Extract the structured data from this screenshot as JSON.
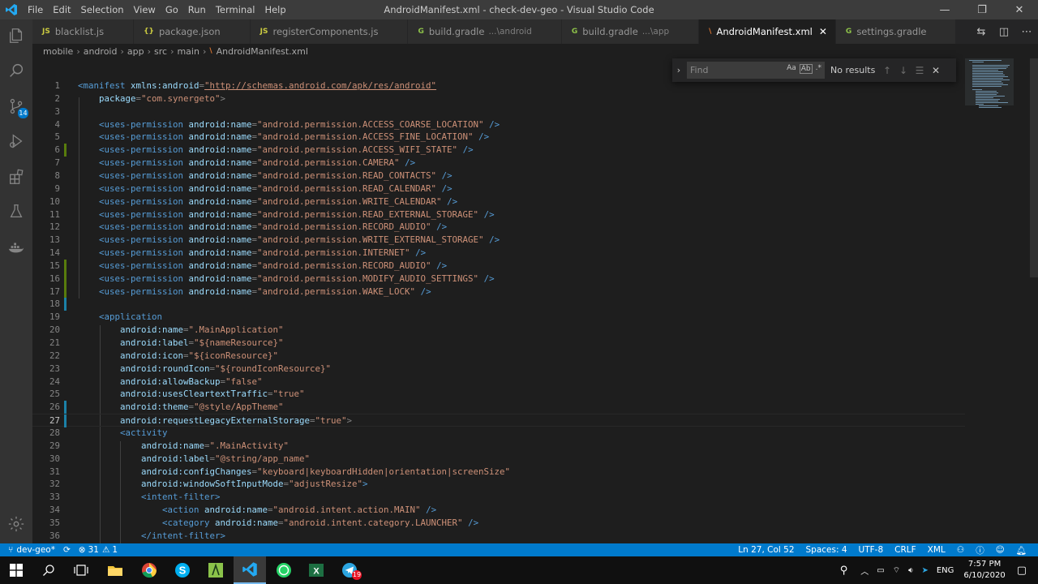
{
  "window": {
    "title": "AndroidManifest.xml - check-dev-geo - Visual Studio Code",
    "menu": [
      "File",
      "Edit",
      "Selection",
      "View",
      "Go",
      "Run",
      "Terminal",
      "Help"
    ],
    "controls": {
      "minimize": "—",
      "maximize": "❐",
      "close": "✕"
    }
  },
  "activity_bar": {
    "icons": [
      "files-icon",
      "search-icon",
      "source-control-icon",
      "run-debug-icon",
      "extensions-icon",
      "testing-icon",
      "docker-icon",
      "settings-gear-icon"
    ],
    "scm_badge": "14"
  },
  "tabs": [
    {
      "icon": "JS",
      "icon_color": "#cbcb41",
      "label": "blacklist.js",
      "desc": ""
    },
    {
      "icon": "{}",
      "icon_color": "#cbcb41",
      "label": "package.json",
      "desc": ""
    },
    {
      "icon": "JS",
      "icon_color": "#cbcb41",
      "label": "registerComponents.js",
      "desc": ""
    },
    {
      "icon": "G",
      "icon_color": "#8dc149",
      "label": "build.gradle",
      "desc": "...\\android"
    },
    {
      "icon": "G",
      "icon_color": "#8dc149",
      "label": "build.gradle",
      "desc": "...\\app"
    },
    {
      "icon": "\\",
      "icon_color": "#e37933",
      "label": "AndroidManifest.xml",
      "desc": "",
      "active": true
    },
    {
      "icon": "G",
      "icon_color": "#8dc149",
      "label": "settings.gradle",
      "desc": ""
    }
  ],
  "breadcrumb": [
    "mobile",
    "android",
    "app",
    "src",
    "main",
    "AndroidManifest.xml"
  ],
  "find": {
    "placeholder": "Find",
    "result": "No results",
    "opt_case": "Aa",
    "opt_word": "Ab",
    "opt_regex": ".*"
  },
  "code": {
    "lines": [
      {
        "n": "1",
        "segs": [
          [
            "t",
            "<manifest "
          ],
          [
            "a",
            "xmlns:android"
          ],
          [
            "b",
            "="
          ],
          [
            "u",
            "\"http://schemas.android.com/apk/res/android\""
          ]
        ]
      },
      {
        "n": "2",
        "segs": [
          [
            "a",
            "    package"
          ],
          [
            "b",
            "="
          ],
          [
            "s",
            "\"com.synergeto\""
          ],
          [
            "b",
            ">"
          ]
        ]
      },
      {
        "n": "3",
        "segs": []
      },
      {
        "n": "4",
        "segs": [
          [
            "t",
            "    <uses-permission "
          ],
          [
            "a",
            "android:name"
          ],
          [
            "b",
            "="
          ],
          [
            "s",
            "\"android.permission.ACCESS_COARSE_LOCATION\""
          ],
          [
            "t",
            " />"
          ]
        ]
      },
      {
        "n": "5",
        "segs": [
          [
            "t",
            "    <uses-permission "
          ],
          [
            "a",
            "android:name"
          ],
          [
            "b",
            "="
          ],
          [
            "s",
            "\"android.permission.ACCESS_FINE_LOCATION\""
          ],
          [
            "t",
            " />"
          ]
        ]
      },
      {
        "n": "6",
        "segs": [
          [
            "t",
            "    <uses-permission "
          ],
          [
            "a",
            "android:name"
          ],
          [
            "b",
            "="
          ],
          [
            "s",
            "\"android.permission.ACCESS_WIFI_STATE\""
          ],
          [
            "t",
            " />"
          ]
        ],
        "mark": "#587c0c"
      },
      {
        "n": "7",
        "segs": [
          [
            "t",
            "    <uses-permission "
          ],
          [
            "a",
            "android:name"
          ],
          [
            "b",
            "="
          ],
          [
            "s",
            "\"android.permission.CAMERA\""
          ],
          [
            "t",
            " />"
          ]
        ]
      },
      {
        "n": "8",
        "segs": [
          [
            "t",
            "    <uses-permission "
          ],
          [
            "a",
            "android:name"
          ],
          [
            "b",
            "="
          ],
          [
            "s",
            "\"android.permission.READ_CONTACTS\""
          ],
          [
            "t",
            " />"
          ]
        ]
      },
      {
        "n": "9",
        "segs": [
          [
            "t",
            "    <uses-permission "
          ],
          [
            "a",
            "android:name"
          ],
          [
            "b",
            "="
          ],
          [
            "s",
            "\"android.permission.READ_CALENDAR\""
          ],
          [
            "t",
            " />"
          ]
        ]
      },
      {
        "n": "10",
        "segs": [
          [
            "t",
            "    <uses-permission "
          ],
          [
            "a",
            "android:name"
          ],
          [
            "b",
            "="
          ],
          [
            "s",
            "\"android.permission.WRITE_CALENDAR\""
          ],
          [
            "t",
            " />"
          ]
        ]
      },
      {
        "n": "11",
        "segs": [
          [
            "t",
            "    <uses-permission "
          ],
          [
            "a",
            "android:name"
          ],
          [
            "b",
            "="
          ],
          [
            "s",
            "\"android.permission.READ_EXTERNAL_STORAGE\""
          ],
          [
            "t",
            " />"
          ]
        ]
      },
      {
        "n": "12",
        "segs": [
          [
            "t",
            "    <uses-permission "
          ],
          [
            "a",
            "android:name"
          ],
          [
            "b",
            "="
          ],
          [
            "s",
            "\"android.permission.RECORD_AUDIO\""
          ],
          [
            "t",
            " />"
          ]
        ]
      },
      {
        "n": "13",
        "segs": [
          [
            "t",
            "    <uses-permission "
          ],
          [
            "a",
            "android:name"
          ],
          [
            "b",
            "="
          ],
          [
            "s",
            "\"android.permission.WRITE_EXTERNAL_STORAGE\""
          ],
          [
            "t",
            " />"
          ]
        ]
      },
      {
        "n": "14",
        "segs": [
          [
            "t",
            "    <uses-permission "
          ],
          [
            "a",
            "android:name"
          ],
          [
            "b",
            "="
          ],
          [
            "s",
            "\"android.permission.INTERNET\""
          ],
          [
            "t",
            " />"
          ]
        ]
      },
      {
        "n": "15",
        "segs": [
          [
            "t",
            "    <uses-permission "
          ],
          [
            "a",
            "android:name"
          ],
          [
            "b",
            "="
          ],
          [
            "s",
            "\"android.permission.RECORD_AUDIO\""
          ],
          [
            "t",
            " />"
          ]
        ],
        "mark": "#587c0c"
      },
      {
        "n": "16",
        "segs": [
          [
            "t",
            "    <uses-permission "
          ],
          [
            "a",
            "android:name"
          ],
          [
            "b",
            "="
          ],
          [
            "s",
            "\"android.permission.MODIFY_AUDIO_SETTINGS\""
          ],
          [
            "t",
            " />"
          ]
        ],
        "mark": "#587c0c"
      },
      {
        "n": "17",
        "segs": [
          [
            "t",
            "    <uses-permission "
          ],
          [
            "a",
            "android:name"
          ],
          [
            "b",
            "="
          ],
          [
            "s",
            "\"android.permission.WAKE_LOCK\""
          ],
          [
            "t",
            " />"
          ]
        ],
        "mark": "#587c0c"
      },
      {
        "n": "18",
        "segs": [],
        "mark": "#1b81a8"
      },
      {
        "n": "19",
        "segs": [
          [
            "t",
            "    <application"
          ]
        ]
      },
      {
        "n": "20",
        "segs": [
          [
            "a",
            "        android:name"
          ],
          [
            "b",
            "="
          ],
          [
            "s",
            "\".MainApplication\""
          ]
        ]
      },
      {
        "n": "21",
        "segs": [
          [
            "a",
            "        android:label"
          ],
          [
            "b",
            "="
          ],
          [
            "s",
            "\"${nameResource}\""
          ]
        ]
      },
      {
        "n": "22",
        "segs": [
          [
            "a",
            "        android:icon"
          ],
          [
            "b",
            "="
          ],
          [
            "s",
            "\"${iconResource}\""
          ]
        ]
      },
      {
        "n": "23",
        "segs": [
          [
            "a",
            "        android:roundIcon"
          ],
          [
            "b",
            "="
          ],
          [
            "s",
            "\"${roundIconResource}\""
          ]
        ]
      },
      {
        "n": "24",
        "segs": [
          [
            "a",
            "        android:allowBackup"
          ],
          [
            "b",
            "="
          ],
          [
            "s",
            "\"false\""
          ]
        ]
      },
      {
        "n": "25",
        "segs": [
          [
            "a",
            "        android:usesCleartextTraffic"
          ],
          [
            "b",
            "="
          ],
          [
            "s",
            "\"true\""
          ]
        ]
      },
      {
        "n": "26",
        "segs": [
          [
            "a",
            "        android:theme"
          ],
          [
            "b",
            "="
          ],
          [
            "s",
            "\"@style/AppTheme\""
          ]
        ],
        "mark": "#1b81a8"
      },
      {
        "n": "27",
        "segs": [
          [
            "a",
            "        android:requestLegacyExternalStorage"
          ],
          [
            "b",
            "="
          ],
          [
            "s",
            "\"true\""
          ],
          [
            "b",
            ">"
          ]
        ],
        "mark": "#1b81a8",
        "current": true
      },
      {
        "n": "28",
        "segs": [
          [
            "t",
            "        <activity"
          ]
        ]
      },
      {
        "n": "29",
        "segs": [
          [
            "a",
            "            android:name"
          ],
          [
            "b",
            "="
          ],
          [
            "s",
            "\".MainActivity\""
          ]
        ]
      },
      {
        "n": "30",
        "segs": [
          [
            "a",
            "            android:label"
          ],
          [
            "b",
            "="
          ],
          [
            "s",
            "\"@string/app_name\""
          ]
        ]
      },
      {
        "n": "31",
        "segs": [
          [
            "a",
            "            android:configChanges"
          ],
          [
            "b",
            "="
          ],
          [
            "s",
            "\"keyboard|keyboardHidden|orientation|screenSize\""
          ]
        ]
      },
      {
        "n": "32",
        "segs": [
          [
            "a",
            "            android:windowSoftInputMode"
          ],
          [
            "b",
            "="
          ],
          [
            "s",
            "\"adjustResize\""
          ],
          [
            "t",
            ">"
          ]
        ]
      },
      {
        "n": "33",
        "segs": [
          [
            "t",
            "            <intent-filter>"
          ]
        ]
      },
      {
        "n": "34",
        "segs": [
          [
            "t",
            "                <action "
          ],
          [
            "a",
            "android:name"
          ],
          [
            "b",
            "="
          ],
          [
            "s",
            "\"android.intent.action.MAIN\""
          ],
          [
            "t",
            " />"
          ]
        ]
      },
      {
        "n": "35",
        "segs": [
          [
            "t",
            "                <category "
          ],
          [
            "a",
            "android:name"
          ],
          [
            "b",
            "="
          ],
          [
            "s",
            "\"android.intent.category.LAUNCHER\""
          ],
          [
            "t",
            " />"
          ]
        ]
      },
      {
        "n": "36",
        "segs": [
          [
            "t",
            "            </intent-filter>"
          ]
        ]
      }
    ]
  },
  "status": {
    "branch": "dev-geo*",
    "problems": "31",
    "warnings": "1",
    "position": "Ln 27, Col 52",
    "spaces": "Spaces: 4",
    "encoding": "UTF-8",
    "eol": "CRLF",
    "language": "XML"
  },
  "taskbar": {
    "apps": [
      "windows-start-icon",
      "search-icon",
      "task-view-icon",
      "file-explorer-icon",
      "chrome-icon",
      "skype-icon",
      "android-studio-icon",
      "vscode-icon",
      "whatsapp-icon",
      "excel-icon",
      "telegram-icon"
    ],
    "telegram_badge": "19",
    "lang": "ENG",
    "time": "7:57 PM",
    "date": "6/10/2020"
  },
  "colors": {
    "accent": "#007acc",
    "titlebar": "#3c3c3c",
    "editor_bg": "#1e1e1e"
  }
}
